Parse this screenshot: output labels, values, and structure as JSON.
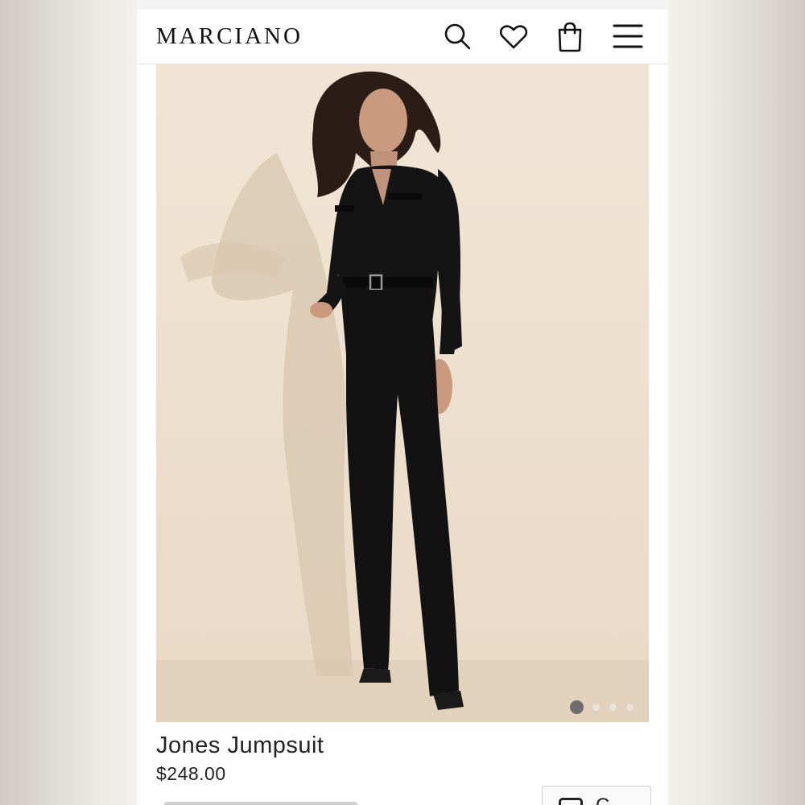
{
  "header": {
    "logo": "MARCIANO",
    "icons": [
      "search-icon",
      "heart-icon",
      "shopping-bag-icon",
      "hamburger-menu-icon"
    ]
  },
  "hero": {
    "slide_count": 4,
    "active_slide": 1
  },
  "product": {
    "name": "Jones Jumpsuit",
    "price": "$248.00"
  },
  "action": {
    "label": "C"
  },
  "colors": {
    "page_background": "#ffffff",
    "photo_background": "#eadbc7",
    "text": "#222222",
    "active_dot": "#6d6d6d"
  }
}
